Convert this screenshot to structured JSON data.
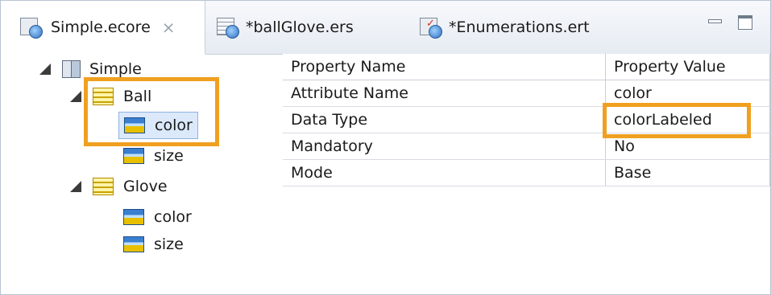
{
  "tabs": [
    {
      "label": "Simple.ecore",
      "close": "⨯",
      "icon": "ecore-model-icon"
    },
    {
      "label": "*ballGlove.ers",
      "icon": "ers-table-icon"
    },
    {
      "label": "*Enumerations.ert",
      "icon": "ert-template-icon"
    }
  ],
  "tree": {
    "root": "Simple",
    "classes": [
      {
        "name": "Ball",
        "attributes": [
          "color",
          "size"
        ]
      },
      {
        "name": "Glove",
        "attributes": [
          "color",
          "size"
        ]
      }
    ]
  },
  "properties": {
    "headers": [
      "Property Name",
      "Property Value"
    ],
    "rows": [
      {
        "name": "Attribute Name",
        "value": "color"
      },
      {
        "name": "Data Type",
        "value": "colorLabeled"
      },
      {
        "name": "Mandatory",
        "value": "No"
      },
      {
        "name": "Mode",
        "value": "Base"
      }
    ]
  },
  "colors": {
    "highlight": "#f0a020",
    "selection": "#dbe9fb"
  }
}
